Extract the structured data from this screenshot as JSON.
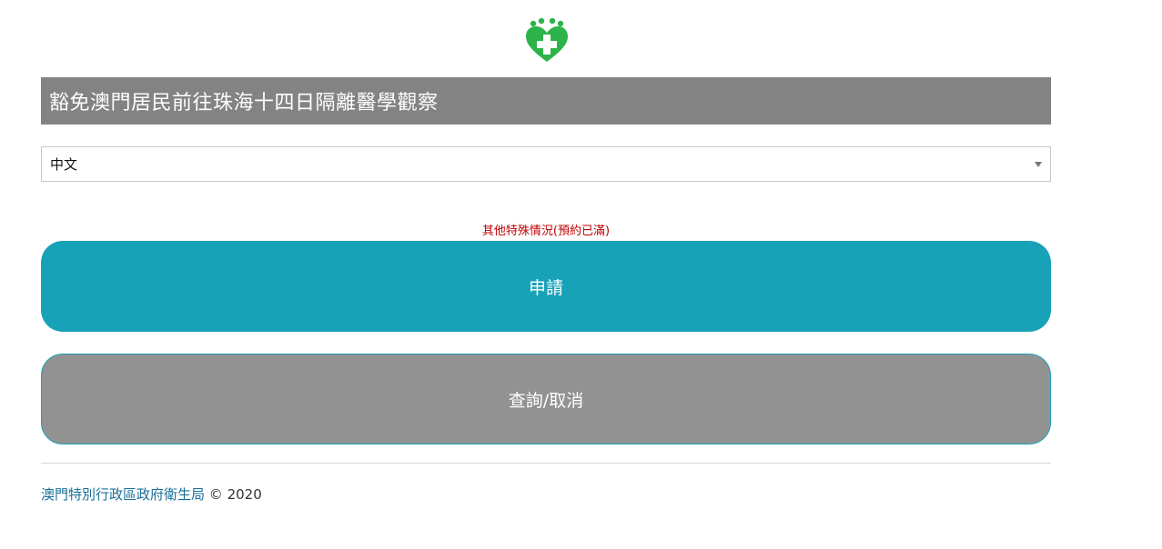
{
  "logo": {
    "icon": "health-heart-cross-icon",
    "color": "#2db34a"
  },
  "header": {
    "title": "豁免澳門居民前往珠海十四日隔離醫學觀察"
  },
  "language_select": {
    "selected": "中文"
  },
  "notice": {
    "text": "其他特殊情況(預約已滿)",
    "color": "#c00000"
  },
  "buttons": {
    "apply_label": "申請",
    "apply_color": "#18a2b8",
    "query_label": "查詢/取消",
    "query_color": "#929292"
  },
  "footer": {
    "link_text": "澳門特別行政區政府衛生局",
    "copyright": "© 2020"
  }
}
